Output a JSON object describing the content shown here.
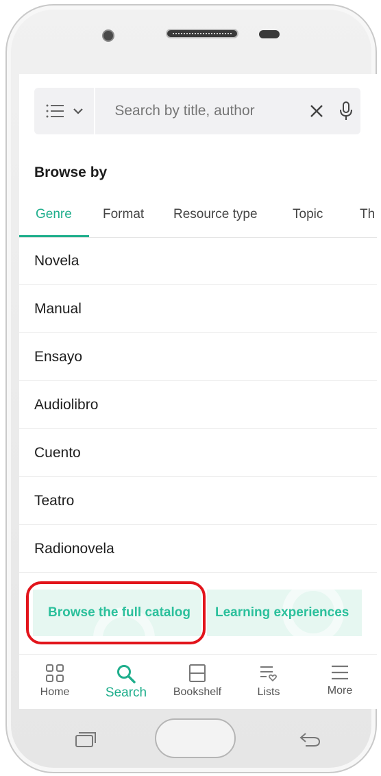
{
  "search": {
    "placeholder": "Search by title, author"
  },
  "browse": {
    "title": "Browse by",
    "tabs": [
      {
        "label": "Genre",
        "active": true
      },
      {
        "label": "Format",
        "active": false
      },
      {
        "label": "Resource type",
        "active": false
      },
      {
        "label": "Topic",
        "active": false
      },
      {
        "label": "Th",
        "active": false
      }
    ],
    "genres": [
      "Novela",
      "Manual",
      "Ensayo",
      "Audiolibro",
      "Cuento",
      "Teatro",
      "Radionovela"
    ]
  },
  "promos": {
    "full_catalog": "Browse the full catalog",
    "learning": "Learning experiences"
  },
  "nav": {
    "items": [
      {
        "label": "Home",
        "icon": "grid-icon",
        "active": false
      },
      {
        "label": "Search",
        "icon": "search-icon",
        "active": true
      },
      {
        "label": "Bookshelf",
        "icon": "bookshelf-icon",
        "active": false
      },
      {
        "label": "Lists",
        "icon": "lists-icon",
        "active": false
      },
      {
        "label": "More",
        "icon": "menu-icon",
        "active": false
      }
    ]
  },
  "colors": {
    "accent": "#1fae8c",
    "highlight": "#e2141b"
  }
}
